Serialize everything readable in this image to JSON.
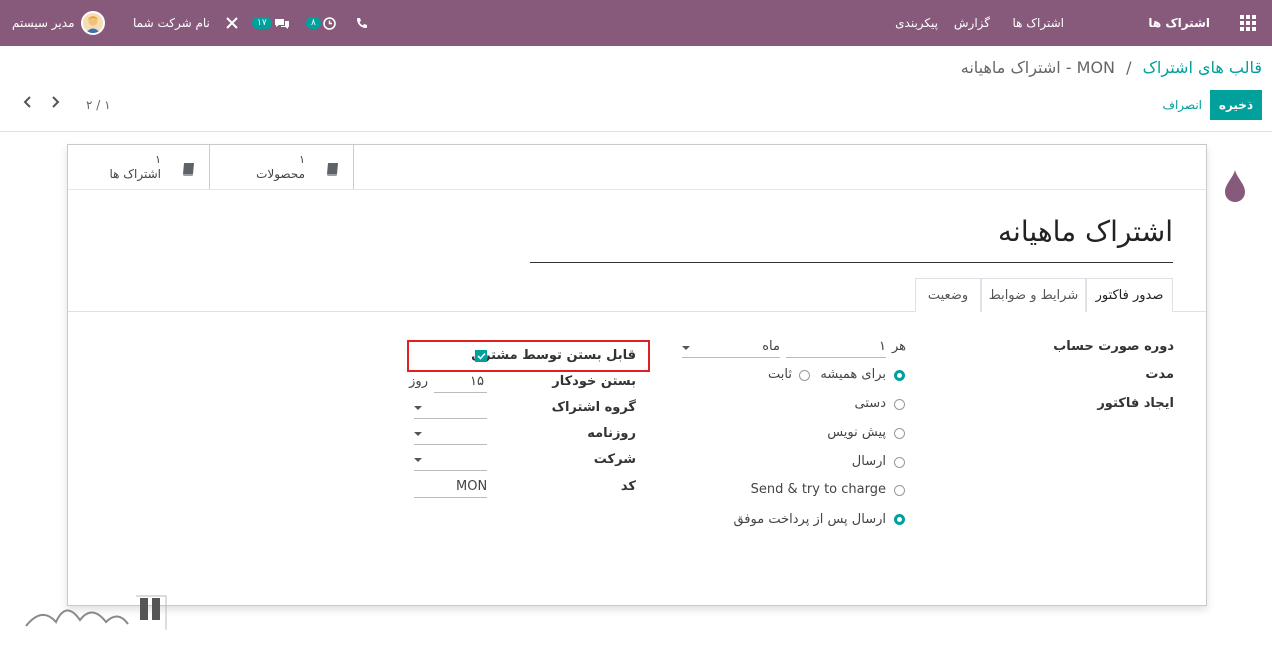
{
  "topbar": {
    "app_name": "اشتراک ها",
    "menu": [
      "اشتراک ها",
      "گزارش",
      "پیکربندی"
    ],
    "user": "مدیر سیستم",
    "company": "نام شرکت شما",
    "messages_count": "۱۷",
    "activities_count": "۸",
    "accent": "#875a7b"
  },
  "breadcrumb": {
    "parent": "قالب های اشتراک",
    "current": "MON - اشتراک ماهیانه",
    "separator": "/"
  },
  "actions": {
    "save": "ذخیره",
    "discard": "انصراف"
  },
  "pager": {
    "value": "۱ / ۲"
  },
  "smart_buttons": [
    {
      "count": "۱",
      "label": "محصولات",
      "icon": "book-icon"
    },
    {
      "count": "۱",
      "label": "اشتراک ها",
      "icon": "book-icon"
    }
  ],
  "record": {
    "title": "اشتراک ماهیانه"
  },
  "tabs": [
    "صدور فاکتور",
    "شرایط و ضوابط",
    "وضعیت"
  ],
  "billing": {
    "period_label": "دوره صورت حساب",
    "every_word": "هر",
    "every_value": "۱",
    "period_unit": "ماه",
    "duration_label": "مدت",
    "duration_options": [
      {
        "label": "برای همیشه",
        "selected": true
      },
      {
        "label": "ثابت",
        "selected": false
      }
    ],
    "invoice_label": "ایجاد فاکتور",
    "invoice_options": [
      {
        "label": "دستی",
        "selected": false
      },
      {
        "label": "پیش نویس",
        "selected": false
      },
      {
        "label": "ارسال",
        "selected": false
      },
      {
        "label": "Send & try to charge",
        "selected": false
      },
      {
        "label": "ارسال پس از پرداخت موفق",
        "selected": true
      }
    ]
  },
  "right_fields": {
    "closable_label": "قابل بستن توسط مشتری",
    "closable_checked": true,
    "auto_close_label": "بستن خودکار",
    "auto_close_value": "۱۵",
    "auto_close_unit": "روز",
    "group_label": "گروه اشتراک",
    "journal_label": "روزنامه",
    "company_label": "شرکت",
    "code_label": "کد",
    "code_value": "MON"
  }
}
